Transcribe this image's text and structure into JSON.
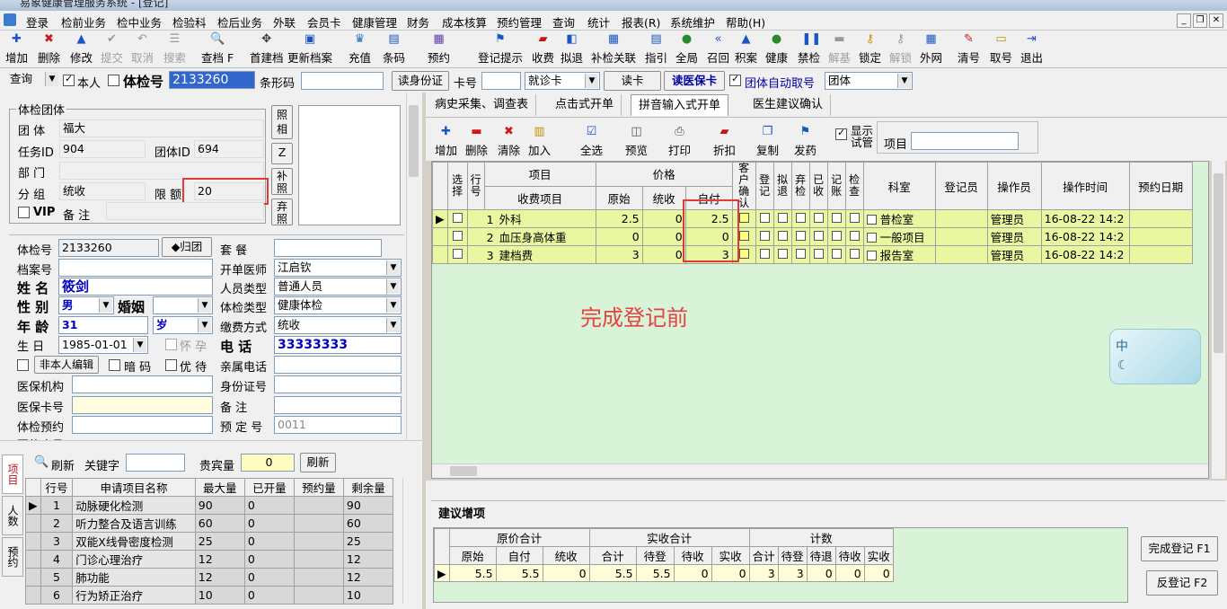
{
  "window": {
    "title": "易象健康管理服务系统 - [登记]"
  },
  "menu": [
    "登录",
    "检前业务",
    "检中业务",
    "检验科",
    "检后业务",
    "外联",
    "会员卡",
    "健康管理",
    "财务",
    "成本核算",
    "预约管理",
    "查询",
    "统计",
    "报表(R)",
    "系统维护",
    "帮助(H)"
  ],
  "toolbar": [
    {
      "label": "增加",
      "icon": "✚",
      "color": "#1a56c8"
    },
    {
      "label": "删除",
      "icon": "✖",
      "color": "#d01818"
    },
    {
      "label": "修改",
      "icon": "▲",
      "color": "#1a56c8"
    },
    {
      "label": "提交",
      "icon": "✔",
      "color": "#999"
    },
    {
      "label": "取消",
      "icon": "↶",
      "color": "#999"
    },
    {
      "label": "搜索",
      "icon": "☰",
      "color": "#999"
    },
    {
      "label": "查档 F",
      "icon": "🔍",
      "color": "#555"
    },
    {
      "label": "首建档",
      "icon": "✥",
      "color": "#333"
    },
    {
      "label": "更新档案",
      "icon": "▣",
      "color": "#1a56c8"
    },
    {
      "label": "充值",
      "icon": "♛",
      "color": "#2a70c8"
    },
    {
      "label": "条码",
      "icon": "▤",
      "color": "#1a56c8"
    },
    {
      "label": "预约",
      "icon": "▦",
      "color": "#6040b0"
    },
    {
      "label": "登记提示",
      "icon": "⚑",
      "color": "#1a56c8"
    },
    {
      "label": "收费",
      "icon": "▰",
      "color": "#c01818"
    },
    {
      "label": "拟退",
      "icon": "◧",
      "color": "#1a56c8"
    },
    {
      "label": "补检关联",
      "icon": "▦",
      "color": "#1a56c8"
    },
    {
      "label": "指引",
      "icon": "▤",
      "color": "#1a56c8"
    },
    {
      "label": "全局",
      "icon": "●",
      "color": "#2a8a2a"
    },
    {
      "label": "召回",
      "icon": "«",
      "color": "#1a56c8"
    },
    {
      "label": "积案",
      "icon": "▲",
      "color": "#1a56c8"
    },
    {
      "label": "健康",
      "icon": "●",
      "color": "#2a8a2a"
    },
    {
      "label": "禁检",
      "icon": "❚❚",
      "color": "#1a56c8"
    },
    {
      "label": "解基",
      "icon": "▬",
      "color": "#999"
    },
    {
      "label": "锁定",
      "icon": "⚷",
      "color": "#d09000"
    },
    {
      "label": "解锁",
      "icon": "⚷",
      "color": "#999"
    },
    {
      "label": "外网",
      "icon": "▦",
      "color": "#1a56c8"
    },
    {
      "label": "清号",
      "icon": "✎",
      "color": "#c01818"
    },
    {
      "label": "取号",
      "icon": "▭",
      "color": "#c09000"
    },
    {
      "label": "退出",
      "icon": "⇥",
      "color": "#1a56c8"
    }
  ],
  "search_row": {
    "query_label": "查询",
    "self_label": "本人",
    "exam_no_label": "体检号",
    "exam_no": "2133260",
    "barcode_label": "条形码",
    "read_id_btn": "读身份证",
    "card_label": "卡号",
    "card_type": "就诊卡",
    "read_card_btn": "读卡",
    "read_insurance_btn": "读医保卡",
    "auto_group_label": "团体自动取号",
    "group_value": "团体"
  },
  "group_box": {
    "title": "体检团体",
    "group_label": "团 体",
    "group": "福大",
    "task_label": "任务ID",
    "task_id": "904",
    "group_id_label": "团体ID",
    "group_id": "694",
    "dept_label": "部 门",
    "dept": "",
    "sub_label": "分 组",
    "sub": "统收",
    "limit_label": "限 额",
    "limit": "20",
    "vip_label": "VIP",
    "note_label": "备 注",
    "note": "",
    "photo_btn": "照相",
    "z_btn": "Z",
    "rephoto_btn": "补照",
    "discard_btn": "弃照"
  },
  "person": {
    "exam_no_label": "体检号",
    "exam_no": "2133260",
    "back_group_btn": "◆归团",
    "package_label": "套 餐",
    "package": "",
    "file_no_label": "档案号",
    "file_no": "",
    "doctor_label": "开单医师",
    "doctor": "江启钦",
    "name_label": "姓 名",
    "name": "筱剑",
    "ptype_label": "人员类型",
    "ptype": "普通人员",
    "sex_label": "性 别",
    "sex": "男",
    "marital_label": "婚姻",
    "marital": "",
    "etype_label": "体检类型",
    "etype": "健康体检",
    "age_label": "年 龄",
    "age": "31",
    "age_unit": "岁",
    "pay_label": "缴费方式",
    "pay": "统收",
    "birth_label": "生 日",
    "birth": "1985-01-01",
    "pregnant_label": "怀 孕",
    "phone_label": "电 话",
    "phone": "33333333",
    "edit_btn": "非本人编辑",
    "secret_label": "暗 码",
    "priority_label": "优 待",
    "family_phone_label": "亲属电话",
    "insurer_label": "医保机构",
    "id_label": "身份证号",
    "ins_card_label": "医保卡号",
    "remark_label": "备 注",
    "reserve_label": "体检预约",
    "reserve_no_label": "预 定 号",
    "reserve_no": "0011",
    "more_label": "团体序号"
  },
  "lower_left": {
    "tabs": [
      "项目",
      "人数",
      "预约"
    ],
    "refresh_btn": "刷新",
    "keyword_label": "关键字",
    "vip_qty_label": "贵宾量",
    "vip_qty": "0",
    "refresh2_btn": "刷新",
    "headers": [
      "行号",
      "申请项目名称",
      "最大量",
      "已开量",
      "预约量",
      "剩余量"
    ],
    "rows": [
      [
        "1",
        "动脉硬化检测",
        "90",
        "0",
        "",
        "90"
      ],
      [
        "2",
        "听力整合及语言训练",
        "60",
        "0",
        "",
        "60"
      ],
      [
        "3",
        "双能X线骨密度检测",
        "25",
        "0",
        "",
        "25"
      ],
      [
        "4",
        "门诊心理治疗",
        "12",
        "0",
        "",
        "12"
      ],
      [
        "5",
        "肺功能",
        "12",
        "0",
        "",
        "12"
      ],
      [
        "6",
        "行为矫正治疗",
        "10",
        "0",
        "",
        "10"
      ]
    ]
  },
  "right_tabs": [
    "病史采集、调查表",
    "点击式开单",
    "拼音输入式开单",
    "医生建议确认"
  ],
  "right_toolbar": {
    "buttons": [
      {
        "label": "增加",
        "icon": "✚",
        "color": "#1a56c8"
      },
      {
        "label": "删除",
        "icon": "▬",
        "color": "#d01818"
      },
      {
        "label": "清除",
        "icon": "✖",
        "color": "#d01818"
      },
      {
        "label": "加入",
        "icon": "▥",
        "color": "#c09000"
      },
      {
        "label": "全选",
        "icon": "☑",
        "color": "#1a56c8"
      },
      {
        "label": "预览",
        "icon": "◫",
        "color": "#555"
      },
      {
        "label": "打印",
        "icon": "⎙",
        "color": "#555"
      },
      {
        "label": "折扣",
        "icon": "▰",
        "color": "#c01818"
      },
      {
        "label": "复制",
        "icon": "❐",
        "color": "#1a56c8"
      },
      {
        "label": "发药",
        "icon": "⚑",
        "color": "#1a56c8"
      }
    ],
    "show_label": "显示试管",
    "item_label": "项目"
  },
  "items_grid": {
    "headers": {
      "select": "选择",
      "row": "行号",
      "item": "项目",
      "fee_item": "收费项目",
      "price": "价格",
      "orig": "原始",
      "unified": "统收",
      "self": "自付",
      "confirm": "客户确认",
      "reg": "登记",
      "quasi": "拟退",
      "abandon": "弃检",
      "collected": "已收",
      "account": "记账",
      "check": "检查",
      "dept": "科室",
      "registrar": "登记员",
      "operator": "操作员",
      "op_time": "操作时间",
      "reserve_date": "预约日期"
    },
    "rows": [
      {
        "no": "1",
        "name": "外科",
        "orig": "2.5",
        "unified": "0",
        "self": "2.5",
        "dept": "普检室",
        "operator": "管理员",
        "time": "16-08-22 14:2"
      },
      {
        "no": "2",
        "name": "血压身高体重",
        "orig": "0",
        "unified": "0",
        "self": "0",
        "dept": "一般项目",
        "operator": "管理员",
        "time": "16-08-22 14:2"
      },
      {
        "no": "3",
        "name": "建档费",
        "orig": "3",
        "unified": "0",
        "self": "3",
        "dept": "报告室",
        "operator": "管理员",
        "time": "16-08-22 14:2"
      }
    ],
    "annotation": "完成登记前"
  },
  "summary": {
    "tab": "建议增项",
    "groups": [
      "原价合计",
      "实收合计",
      "计数"
    ],
    "headers": [
      "原始",
      "自付",
      "统收",
      "合计",
      "待登",
      "待收",
      "实收",
      "合计",
      "待登",
      "待退",
      "待收",
      "实收"
    ],
    "values": [
      "5.5",
      "5.5",
      "0",
      "5.5",
      "5.5",
      "0",
      "0",
      "3",
      "3",
      "0",
      "0",
      "0"
    ],
    "complete_btn": "完成登记 F1",
    "reverse_btn": "反登记 F2"
  },
  "floating_widget": {
    "text": "中"
  }
}
